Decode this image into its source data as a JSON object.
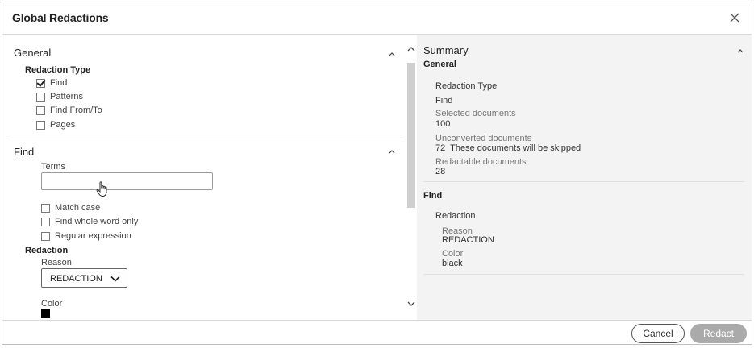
{
  "dialog": {
    "title": "Global Redactions",
    "close_icon": "close-icon"
  },
  "general": {
    "heading": "General",
    "redaction_type_label": "Redaction Type",
    "options": [
      {
        "label": "Find",
        "checked": true
      },
      {
        "label": "Patterns",
        "checked": false
      },
      {
        "label": "Find From/To",
        "checked": false
      },
      {
        "label": "Pages",
        "checked": false
      }
    ]
  },
  "find": {
    "heading": "Find",
    "terms_label": "Terms",
    "terms_value": "",
    "options": [
      {
        "label": "Match case",
        "checked": false
      },
      {
        "label": "Find whole word only",
        "checked": false
      },
      {
        "label": "Regular expression",
        "checked": false
      }
    ],
    "redaction_label": "Redaction",
    "reason_label": "Reason",
    "reason_value": "REDACTION",
    "color_label": "Color",
    "color_value": "#000000"
  },
  "summary": {
    "heading": "Summary",
    "general_heading": "General",
    "redaction_type_label": "Redaction Type",
    "redaction_type_value": "Find",
    "selected_label": "Selected documents",
    "selected_value": "100",
    "unconverted_label": "Unconverted documents",
    "unconverted_value": "72  These documents will be skipped",
    "redactable_label": "Redactable documents",
    "redactable_value": "28",
    "find_heading": "Find",
    "redaction_label": "Redaction",
    "reason_label": "Reason",
    "reason_value": "REDACTION",
    "color_label": "Color",
    "color_value": "black"
  },
  "footer": {
    "cancel_label": "Cancel",
    "redact_label": "Redact"
  }
}
